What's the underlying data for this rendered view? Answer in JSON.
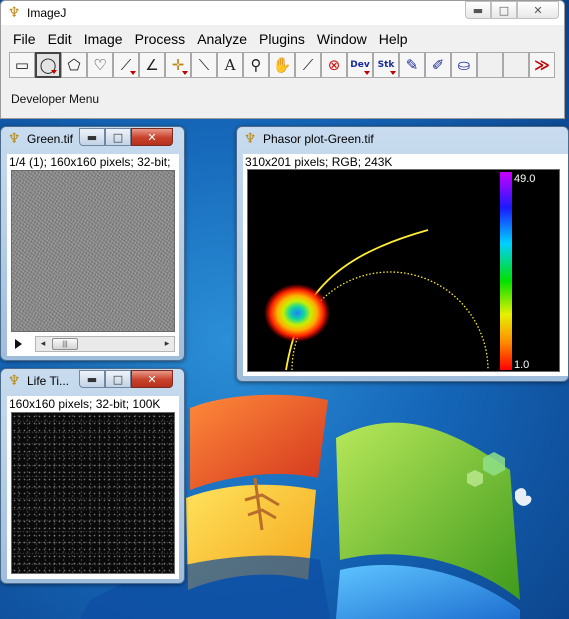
{
  "imagej": {
    "title": "ImageJ",
    "menus": [
      "File",
      "Edit",
      "Image",
      "Process",
      "Analyze",
      "Plugins",
      "Window",
      "Help"
    ],
    "tools": [
      {
        "name": "rectangle-tool",
        "glyph": "▭"
      },
      {
        "name": "oval-tool",
        "glyph": "◯"
      },
      {
        "name": "polygon-tool",
        "glyph": "⬠"
      },
      {
        "name": "freehand-tool",
        "glyph": "♡"
      },
      {
        "name": "line-tool",
        "glyph": "⟋"
      },
      {
        "name": "angle-tool",
        "glyph": "∠"
      },
      {
        "name": "point-tool",
        "glyph": "✛"
      },
      {
        "name": "wand-tool",
        "glyph": "⟍"
      },
      {
        "name": "text-tool",
        "glyph": "A"
      },
      {
        "name": "magnifier-tool",
        "glyph": "⚲"
      },
      {
        "name": "scroll-hand-tool",
        "glyph": "✋"
      },
      {
        "name": "color-picker-tool",
        "glyph": "⟋"
      },
      {
        "name": "stop-tool",
        "glyph": "⊗"
      },
      {
        "name": "dev-menu-tool",
        "glyph": "Dev"
      },
      {
        "name": "stk-menu-tool",
        "glyph": "Stk"
      },
      {
        "name": "pencil-tool",
        "glyph": "✎"
      },
      {
        "name": "brush-tool",
        "glyph": "✐"
      },
      {
        "name": "flood-fill-tool",
        "glyph": "⛀"
      },
      {
        "name": "empty-slot-1",
        "glyph": ""
      },
      {
        "name": "empty-slot-2",
        "glyph": ""
      },
      {
        "name": "more-tools",
        "glyph": "≫"
      }
    ],
    "status": "Developer Menu"
  },
  "green_window": {
    "title": "Green.tif",
    "info": "1/4 (1); 160x160 pixels; 32-bit;",
    "scroll_thumb": "|||"
  },
  "phasor_window": {
    "title": "Phasor plot-Green.tif",
    "info": "310x201 pixels; RGB; 243K",
    "colorbar_max": "49.0",
    "colorbar_min": "1.0"
  },
  "life_window": {
    "title": "Life Ti...",
    "info": "160x160 pixels; 32-bit; 100K"
  },
  "window_controls": {
    "minimize": "▬",
    "maximize": "□",
    "close": "✕"
  },
  "colors": {
    "close_red": "#c7412a",
    "phasor_yellow": "#ffee33",
    "stop_red": "#d01010",
    "dev_blue": "#1a2a9a"
  }
}
